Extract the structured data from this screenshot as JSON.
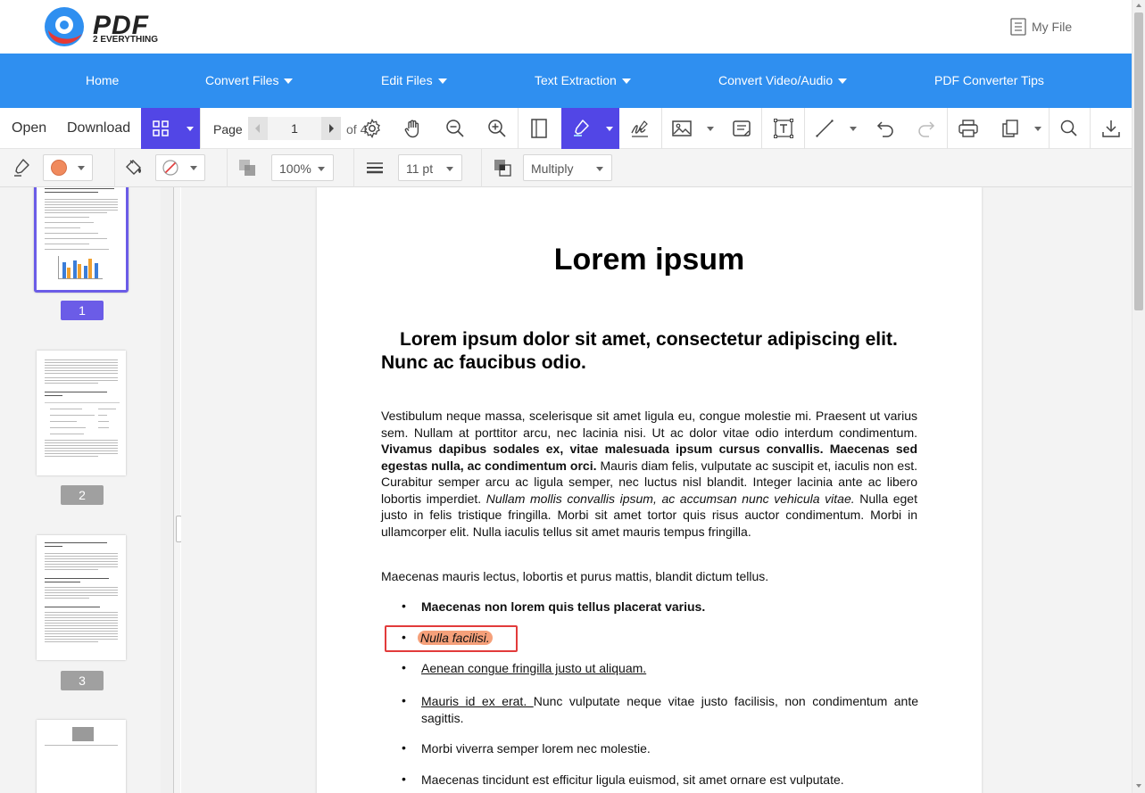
{
  "header": {
    "logo_text": "PDF",
    "logo_sub": "2 EVERYTHING",
    "my_file": "My File"
  },
  "nav": {
    "items": [
      {
        "label": "Home"
      },
      {
        "label": "Convert Files"
      },
      {
        "label": "Edit Files"
      },
      {
        "label": "Text Extraction"
      },
      {
        "label": "Convert Video/Audio"
      },
      {
        "label": "PDF Converter Tips"
      }
    ]
  },
  "toolbar": {
    "open_label": "Open",
    "download_label": "Download",
    "page_label": "Page",
    "current_page": "1",
    "of_label": "of 4"
  },
  "format_bar": {
    "stroke_color": "#f08a5d",
    "opacity": "100%",
    "thickness": "11 pt",
    "blend_mode": "Multiply"
  },
  "thumbnails": [
    {
      "number": "1",
      "selected": true
    },
    {
      "number": "2",
      "selected": false
    },
    {
      "number": "3",
      "selected": false
    }
  ],
  "document": {
    "title": "Lorem ipsum",
    "heading": "Lorem ipsum dolor sit amet, consectetur adipiscing elit. Nunc ac faucibus odio.",
    "p1_a": "Vestibulum neque massa, scelerisque sit amet ligula eu, congue molestie mi. Praesent ut varius sem. Nullam at porttitor arcu, nec lacinia nisi. Ut ac dolor vitae odio interdum condimentum. ",
    "p1_bold": "Vivamus dapibus sodales ex, vitae malesuada ipsum cursus convallis. Maecenas sed egestas nulla, ac condimentum orci.",
    "p1_b": " Mauris diam felis, vulputate ac suscipit et, iaculis non est. Curabitur semper arcu ac ligula semper, nec luctus nisl blandit. Integer lacinia ante ac libero lobortis imperdiet. ",
    "p1_italic": "Nullam mollis convallis ipsum, ac accumsan nunc vehicula vitae.",
    "p1_c": " Nulla eget justo in felis tristique fringilla. Morbi sit amet tortor quis risus auctor condimentum. Morbi in ullamcorper elit. Nulla iaculis tellus sit amet mauris tempus fringilla.",
    "p2": "Maecenas mauris lectus, lobortis et purus mattis, blandit dictum tellus.",
    "bullet_dot": "•",
    "b1": "Maecenas non lorem quis tellus placerat varius.",
    "b2": "Nulla facilisi.",
    "b3": "Aenean congue fringilla justo ut aliquam. ",
    "b4_u": "Mauris id ex erat. ",
    "b4": "Nunc vulputate neque vitae justo facilisis, non condimentum ante sagittis.",
    "b5": "Morbi viverra semper lorem nec molestie.",
    "b6": "Maecenas tincidunt est efficitur ligula euismod, sit amet ornare est vulputate."
  },
  "colors": {
    "nav_bg": "#2f8ff0",
    "active_tool": "#5246e6",
    "highlight": "#f5a07a",
    "annotation_box": "#e23b3b",
    "thumb_selected": "#6b5ce7",
    "thumb_badge": "#a0a0a0"
  }
}
